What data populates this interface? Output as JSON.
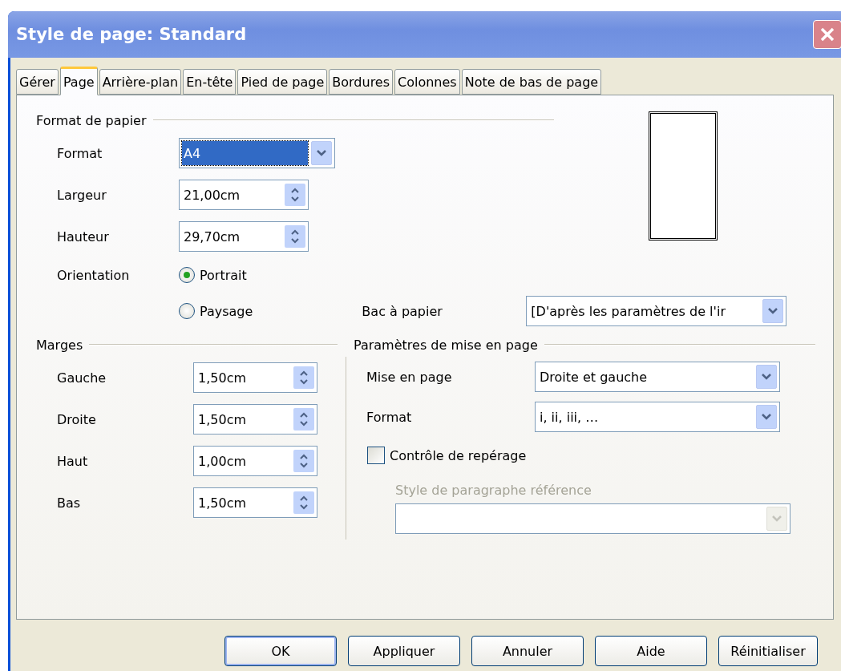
{
  "window": {
    "title": "Style de page: Standard"
  },
  "tabs": [
    {
      "label": "Gérer",
      "selected": false
    },
    {
      "label": "Page",
      "selected": true
    },
    {
      "label": "Arrière-plan",
      "selected": false
    },
    {
      "label": "En-tête",
      "selected": false
    },
    {
      "label": "Pied de page",
      "selected": false
    },
    {
      "label": "Bordures",
      "selected": false
    },
    {
      "label": "Colonnes",
      "selected": false
    },
    {
      "label": "Note de bas de page",
      "selected": false
    }
  ],
  "paper_format": {
    "heading": "Format de papier",
    "fields": [
      {
        "label": "Format",
        "kind": "combo",
        "value": "A4",
        "highlighted": true
      },
      {
        "label": "Largeur",
        "kind": "spin",
        "value": "21,00cm"
      },
      {
        "label": "Hauteur",
        "kind": "spin",
        "value": "29,70cm"
      }
    ],
    "orientation": {
      "label": "Orientation",
      "options": [
        {
          "label": "Portrait",
          "selected": true
        },
        {
          "label": "Paysage",
          "selected": false
        }
      ]
    },
    "paper_tray": {
      "label": "Bac à papier",
      "value": "[D'après les paramètres de l'ir"
    }
  },
  "margins": {
    "heading": "Marges",
    "fields": [
      {
        "label": "Gauche",
        "value": "1,50cm"
      },
      {
        "label": "Droite",
        "value": "1,50cm"
      },
      {
        "label": "Haut",
        "value": "1,00cm"
      },
      {
        "label": "Bas",
        "value": "1,50cm"
      }
    ]
  },
  "layout_settings": {
    "heading": "Paramètres de mise en page",
    "fields": [
      {
        "label": "Mise en page",
        "value": "Droite et gauche"
      },
      {
        "label": "Format",
        "value": "i, ii, iii, …"
      }
    ],
    "register_true": {
      "label": "Contrôle de repérage",
      "checked": false
    },
    "reference_style": {
      "label": "Style de paragraphe référence",
      "disabled": true
    }
  },
  "buttons": [
    {
      "label": "OK",
      "default": true
    },
    {
      "label": "Appliquer",
      "default": false
    },
    {
      "label": "Annuler",
      "default": false
    },
    {
      "label": "Aide",
      "default": false
    },
    {
      "label": "Réinitialiser",
      "default": false
    }
  ]
}
